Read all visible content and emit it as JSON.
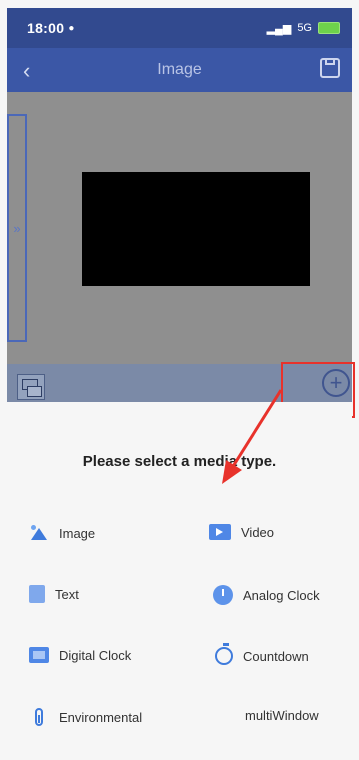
{
  "status_bar": {
    "time": "18:00",
    "user_icon": "person-icon",
    "network": "5G",
    "signal_icon": "signal-icon",
    "battery_icon": "battery-charging-icon"
  },
  "nav": {
    "back_icon": "chevron-left-icon",
    "title": "Image",
    "save_icon": "save-icon"
  },
  "canvas": {
    "sidebar_toggle": "»"
  },
  "toolbar": {
    "media_icon": "media-thumbnail-icon",
    "add_icon": "plus-circle-icon",
    "add_label": "+"
  },
  "sheet": {
    "prompt": "Please select a media type.",
    "options": [
      {
        "label": "Image",
        "icon": "image-icon"
      },
      {
        "label": "Video",
        "icon": "video-icon"
      },
      {
        "label": "Text",
        "icon": "text-icon"
      },
      {
        "label": "Analog Clock",
        "icon": "analog-clock-icon"
      },
      {
        "label": "Digital Clock",
        "icon": "digital-clock-icon"
      },
      {
        "label": "Countdown",
        "icon": "countdown-icon"
      },
      {
        "label": "Environmental",
        "icon": "thermometer-icon"
      },
      {
        "label": "multiWindow",
        "icon": ""
      }
    ]
  },
  "colors": {
    "nav_bg": "#3b57a6",
    "status_bg": "#324a8f",
    "highlight": "#e8322b",
    "accent": "#3f7bdc"
  }
}
